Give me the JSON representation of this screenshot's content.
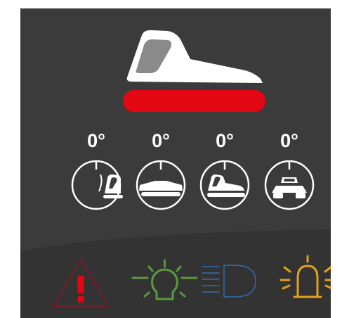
{
  "angles": [
    {
      "id": "pitch",
      "icon": "machine-side-pitch-icon",
      "value": "0°"
    },
    {
      "id": "roll",
      "icon": "machine-front-roll-icon",
      "value": "0°"
    },
    {
      "id": "side",
      "icon": "machine-side-icon",
      "value": "0°"
    },
    {
      "id": "front",
      "icon": "machine-front-icon",
      "value": "0°"
    }
  ],
  "status_bar": {
    "color": "#e30613",
    "state": "red"
  },
  "warning_lights": [
    {
      "icon": "warning-triangle-icon",
      "color": "#a0101d"
    },
    {
      "icon": "position-lights-icon",
      "color": "#5a9a3a"
    },
    {
      "icon": "headlight-icon",
      "color": "#2f7ac4"
    },
    {
      "icon": "beacon-icon",
      "color": "#e3a01b"
    }
  ]
}
